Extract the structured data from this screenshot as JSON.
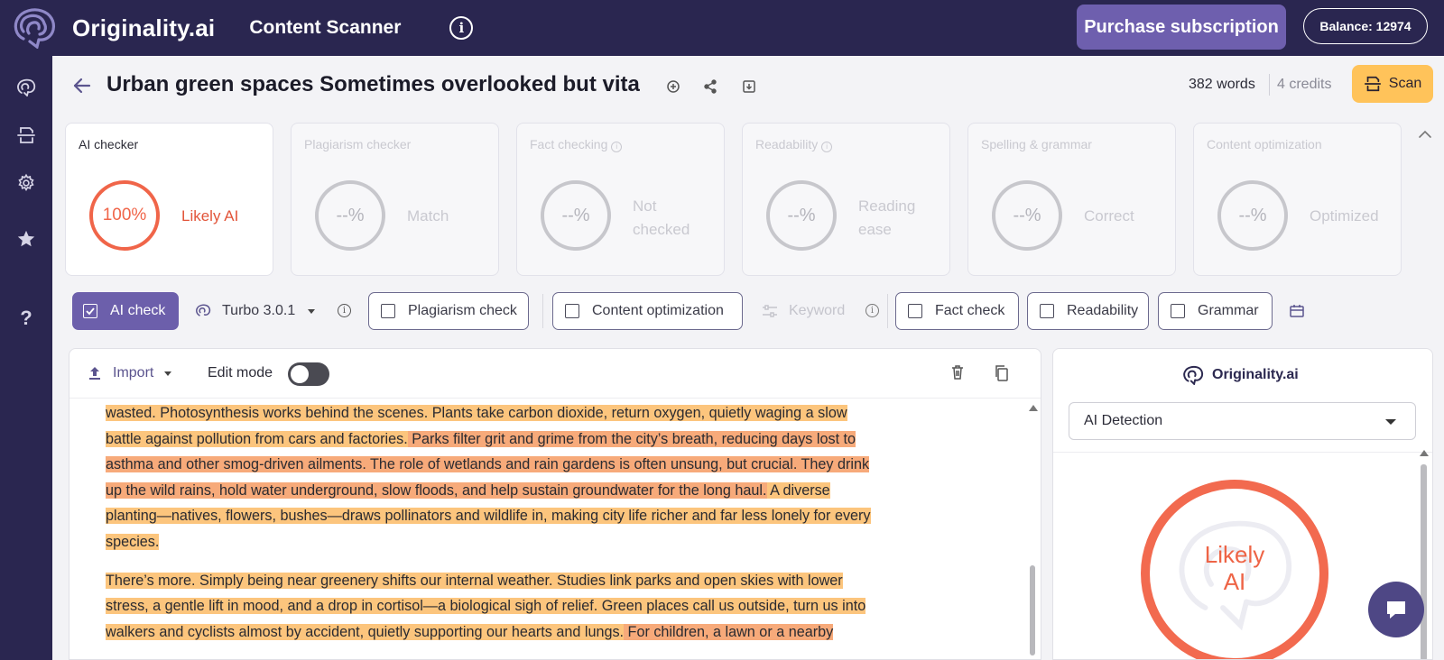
{
  "topbar": {
    "brand": "Originality.ai",
    "app_title": "Content Scanner",
    "purchase_label": "Purchase subscription",
    "balance_label": "Balance: 12974"
  },
  "sidebar": {
    "items": [
      {
        "icon": "brain-icon"
      },
      {
        "icon": "scanner-icon"
      },
      {
        "icon": "gear-icon"
      },
      {
        "icon": "star-icon"
      },
      {
        "icon": "help-icon"
      }
    ]
  },
  "header": {
    "title": "Urban green spaces Sometimes overlooked but vita",
    "word_count": "382 words",
    "credits": "4 credits",
    "scan_label": "Scan"
  },
  "cards": [
    {
      "title": "AI checker",
      "value": "100%",
      "label": "Likely AI",
      "active": true
    },
    {
      "title": "Plagiarism checker",
      "value": "--%",
      "label": "Match",
      "active": false
    },
    {
      "title": "Fact checking",
      "value": "--%",
      "label": "Not checked",
      "label_lines": [
        "Not",
        "checked"
      ],
      "active": false
    },
    {
      "title": "Readability",
      "value": "--%",
      "label": "Reading ease",
      "label_lines": [
        "Reading",
        "ease"
      ],
      "active": false
    },
    {
      "title": "Spelling & grammar",
      "value": "--%",
      "label": "Correct",
      "active": false
    },
    {
      "title": "Content optimization",
      "value": "--%",
      "label": "Optimized",
      "active": false
    }
  ],
  "tools": {
    "ai_check": "AI check",
    "model": "Turbo 3.0.1",
    "plagiarism": "Plagiarism check",
    "content_opt": "Content optimization",
    "keyword": "Keyword",
    "fact": "Fact check",
    "readability": "Readability",
    "grammar": "Grammar"
  },
  "editor": {
    "import_label": "Import",
    "edit_mode_label": "Edit mode",
    "paragraphs": [
      {
        "lines": [
          {
            "text": "wasted.  Photosynthesis works behind the scenes.  Plants take carbon dioxide, return oxygen, quietly waging a slow",
            "tone": "a"
          },
          {
            "text": "battle against pollution from cars and factories.",
            "tone": "a",
            "tail": "  Parks filter grit and grime from the city’s breath, reducing days lost to",
            "tail_tone": "b"
          },
          {
            "text": "asthma and other smog-driven ailments.  The role of wetlands and rain gardens is often unsung, but crucial.  They drink",
            "tone": "b"
          },
          {
            "text": "up the wild rains, hold water underground, slow floods, and help sustain groundwater for the long haul.",
            "tone": "b",
            "tail": "  A diverse",
            "tail_tone": "a"
          },
          {
            "text": "planting—natives, flowers, bushes—draws pollinators and wildlife in, making city life richer and far less lonely for every",
            "tone": "a"
          },
          {
            "text": "species.",
            "tone": "a"
          }
        ]
      },
      {
        "lines": [
          {
            "text": "There’s more.  Simply being near greenery shifts our internal weather.  Studies link parks and open skies with lower",
            "tone": "a"
          },
          {
            "text": "stress, a gentle lift in mood, and a drop in cortisol—a biological sigh of relief.  Green places call us outside, turn us into",
            "tone": "a"
          },
          {
            "text": "walkers and cyclists almost by accident, quietly supporting our hearts and lungs.",
            "tone": "a",
            "tail": "  For children, a lawn or a nearby",
            "tail_tone": "b"
          }
        ]
      }
    ]
  },
  "right_panel": {
    "brand": "Originality.ai",
    "select_value": "AI Detection",
    "result_line1": "Likely",
    "result_line2": "AI"
  },
  "colors": {
    "nav_bg": "#2a2650",
    "accent": "#6c5fab",
    "ai_red": "#f06549",
    "scan_yellow": "#ffc35a",
    "highlight_orange": "#fcc57d",
    "highlight_salmon": "#f7aa7a"
  }
}
